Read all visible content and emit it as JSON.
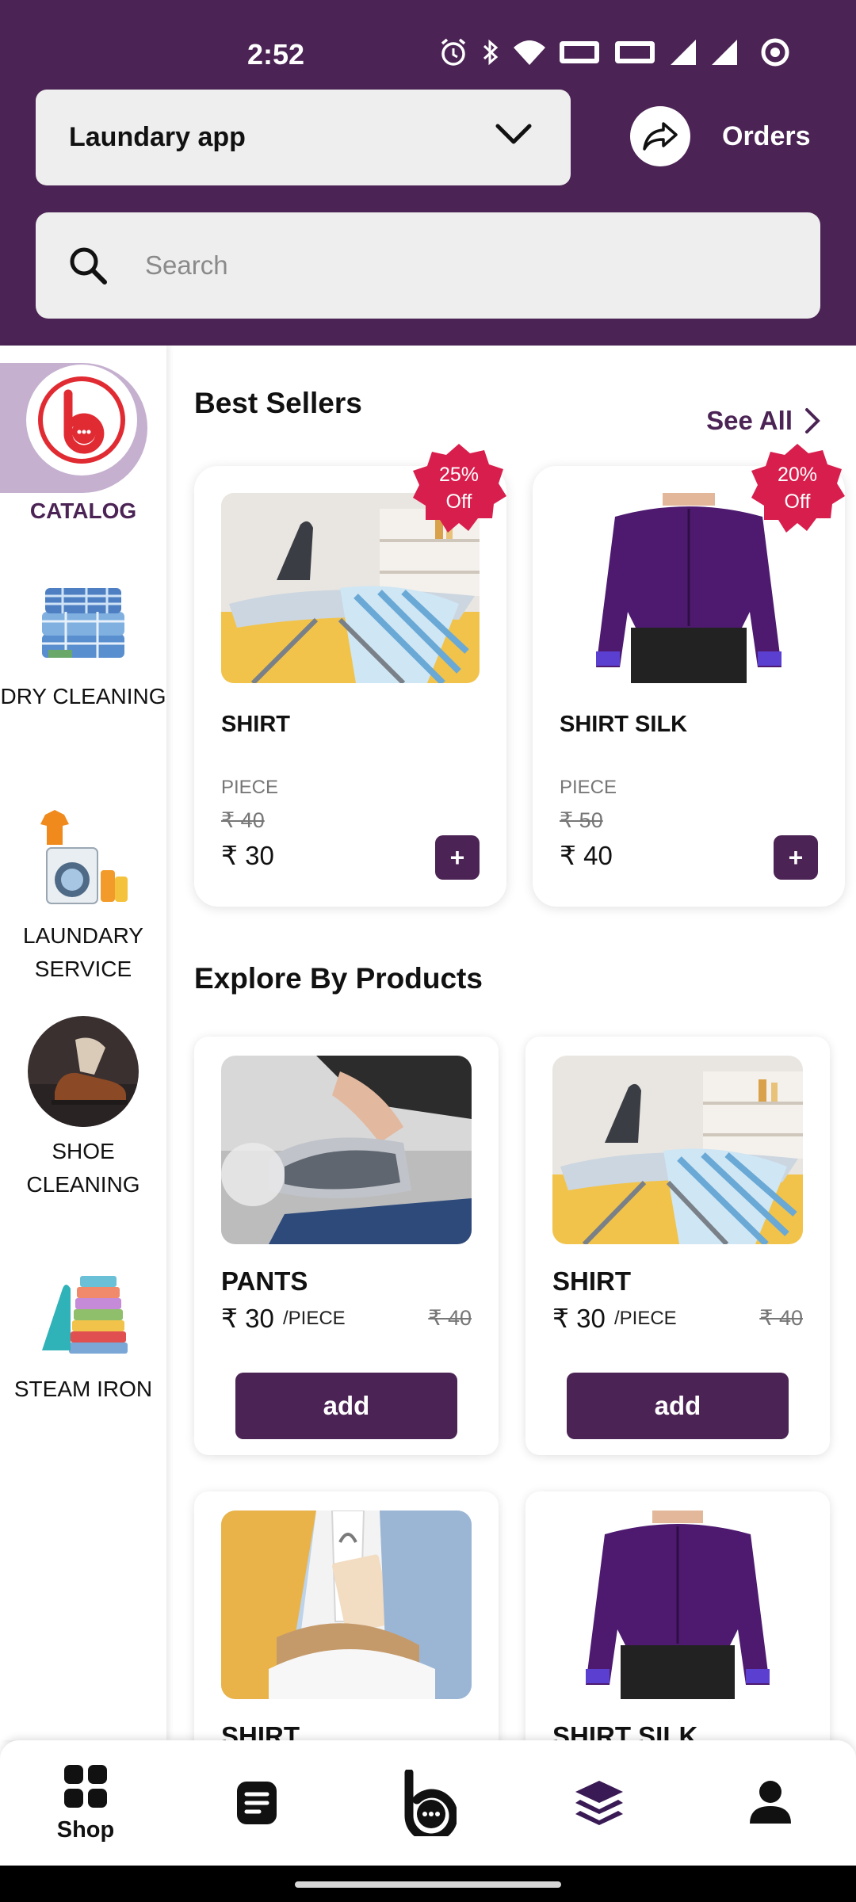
{
  "status": {
    "time": "2:52"
  },
  "header": {
    "store_name": "Laundary app",
    "orders_label": "Orders",
    "search_placeholder": "Search"
  },
  "sidebar": {
    "items": [
      {
        "label": "CATALOG",
        "icon": "catalog-logo-icon",
        "active": true
      },
      {
        "label": "DRY CLEANING",
        "icon": "dry-cleaning-thumb"
      },
      {
        "label": "LAUNDARY SERVICE",
        "icon": "laundry-service-thumb"
      },
      {
        "label": "SHOE CLEANING",
        "icon": "shoe-cleaning-thumb"
      },
      {
        "label": "STEAM IRON",
        "icon": "steam-iron-thumb"
      }
    ]
  },
  "best_sellers": {
    "title": "Best Sellers",
    "see_all": "See All",
    "items": [
      {
        "name": "SHIRT",
        "unit": "PIECE",
        "old_price": "₹ 40",
        "price": "₹ 30",
        "discount": "25%",
        "off": "Off"
      },
      {
        "name": "SHIRT SILK",
        "unit": "PIECE",
        "old_price": "₹ 50",
        "price": "₹ 40",
        "discount": "20%",
        "off": "Off"
      }
    ]
  },
  "explore": {
    "title": "Explore By Products",
    "items": [
      {
        "name": "PANTS",
        "price": "₹ 30",
        "unit": "/PIECE",
        "old_price": "₹ 40",
        "button": "add"
      },
      {
        "name": "SHIRT",
        "price": "₹ 30",
        "unit": "/PIECE",
        "old_price": "₹ 40",
        "button": "add"
      },
      {
        "name": "SHIRT",
        "price": "",
        "unit": "",
        "old_price": "",
        "button": ""
      },
      {
        "name": "SHIRT SILK",
        "price": "",
        "unit": "",
        "old_price": "",
        "button": ""
      }
    ]
  },
  "bottom_nav": {
    "items": [
      {
        "label": "Shop",
        "icon": "grid-icon",
        "active": true
      },
      {
        "label": "",
        "icon": "document-icon"
      },
      {
        "label": "",
        "icon": "chat-logo-icon"
      },
      {
        "label": "",
        "icon": "layers-icon"
      },
      {
        "label": "",
        "icon": "profile-icon"
      }
    ]
  },
  "colors": {
    "primary": "#4b2354",
    "badge": "#d81e4d",
    "accent_light": "#c5b0cf"
  }
}
